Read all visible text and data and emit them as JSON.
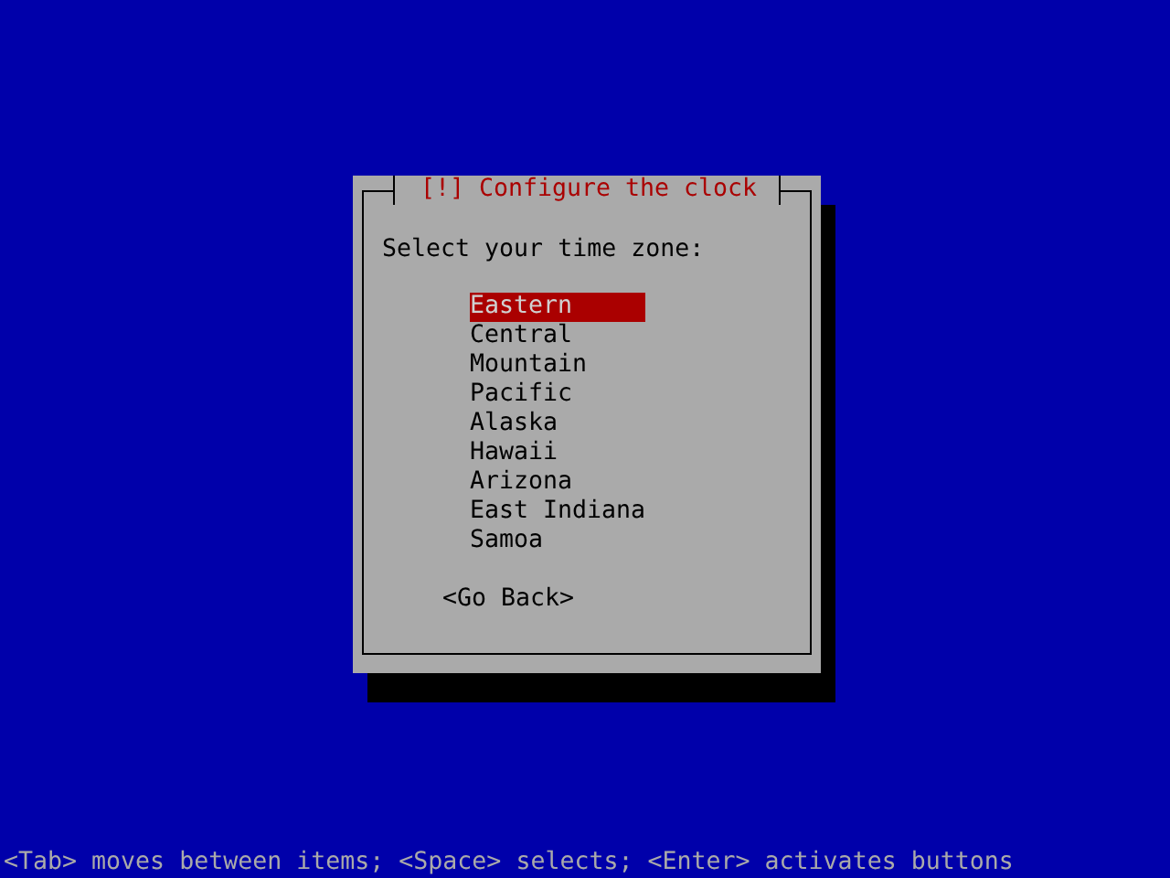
{
  "dialog": {
    "title": "[!] Configure the clock",
    "prompt": "Select your time zone:",
    "zones": [
      {
        "label": "Eastern",
        "selected": true
      },
      {
        "label": "Central",
        "selected": false
      },
      {
        "label": "Mountain",
        "selected": false
      },
      {
        "label": "Pacific",
        "selected": false
      },
      {
        "label": "Alaska",
        "selected": false
      },
      {
        "label": "Hawaii",
        "selected": false
      },
      {
        "label": "Arizona",
        "selected": false
      },
      {
        "label": "East Indiana",
        "selected": false
      },
      {
        "label": "Samoa",
        "selected": false
      }
    ],
    "buttons": [
      {
        "label": "<Go Back>"
      }
    ]
  },
  "hint": "<Tab> moves between items; <Space> selects; <Enter> activates buttons"
}
